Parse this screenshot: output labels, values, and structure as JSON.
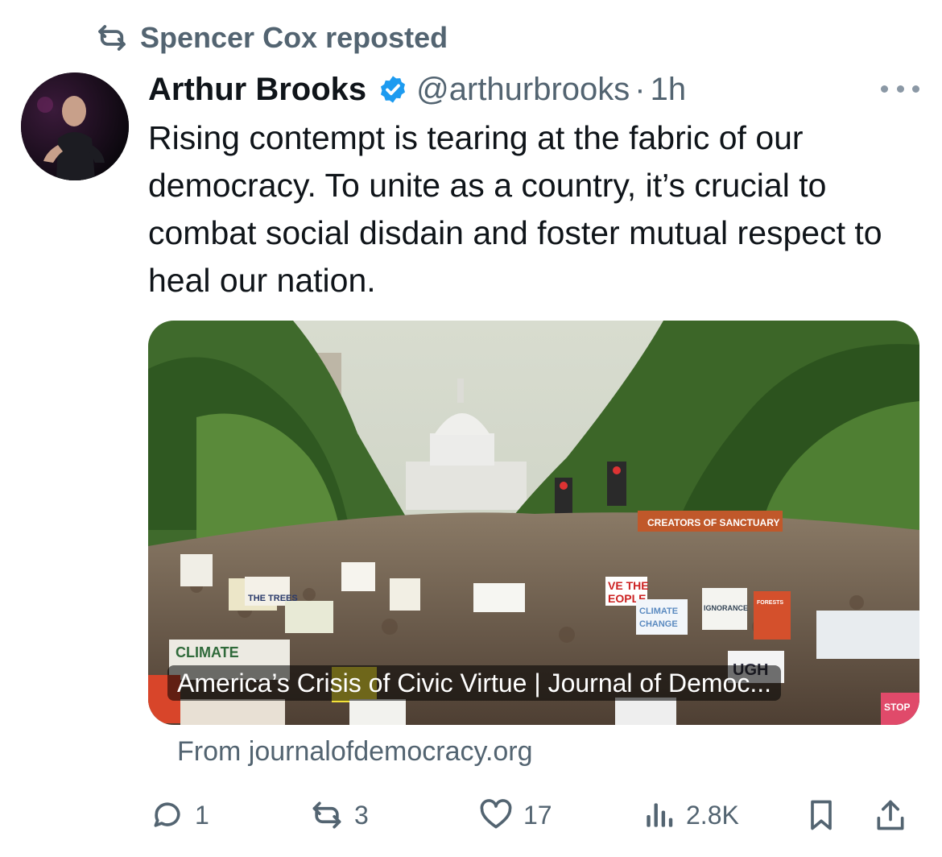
{
  "repost": {
    "label": "Spencer Cox reposted",
    "icon": "repost-icon"
  },
  "tweet": {
    "author_name": "Arthur Brooks",
    "handle": "@arthurbrooks",
    "separator": "·",
    "age": "1h",
    "verified_icon": "verified-badge-icon",
    "text": "Rising contempt is tearing at the fabric of our democracy. To unite as a country, it’s crucial to combat social disdain and foster mutual respect to heal our nation."
  },
  "link_card": {
    "title": "America’s Crisis of Civic Virtue | Journal of Democ...",
    "source": "From journalofdemocracy.org",
    "signs": [
      "VE THE",
      "EOPLE",
      "CLIMATE",
      "CHANGE",
      "CREATORS OF SANCTUARY",
      "STOP",
      "THE TREES",
      "UGH",
      "FORESTS",
      "IGNORANCE"
    ]
  },
  "actions": {
    "reply_count": "1",
    "repost_count": "3",
    "like_count": "17",
    "views_count": "2.8K"
  },
  "colors": {
    "text_primary": "#0f1419",
    "text_secondary": "#536471",
    "verified_blue": "#1d9bf0"
  }
}
